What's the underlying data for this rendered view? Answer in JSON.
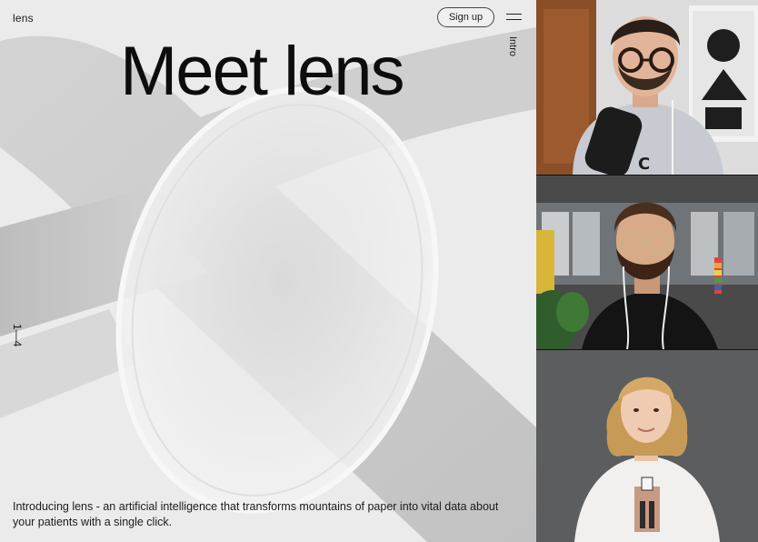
{
  "landing": {
    "brand": "lens",
    "signup_label": "Sign up",
    "intro_label": "Intro",
    "headline": "Meet lens",
    "pager": "1—4",
    "description": "Introducing lens - an artificial intelligence that transforms mountains of paper into vital data about your patients with a single click."
  },
  "participants": [
    {
      "icon": "participant-video-man-glasses-headphones"
    },
    {
      "icon": "participant-video-man-beard-glasses"
    },
    {
      "icon": "participant-video-woman-blonde"
    }
  ],
  "colors": {
    "landing_bg": "#ececec",
    "text": "#0d0d0d"
  }
}
